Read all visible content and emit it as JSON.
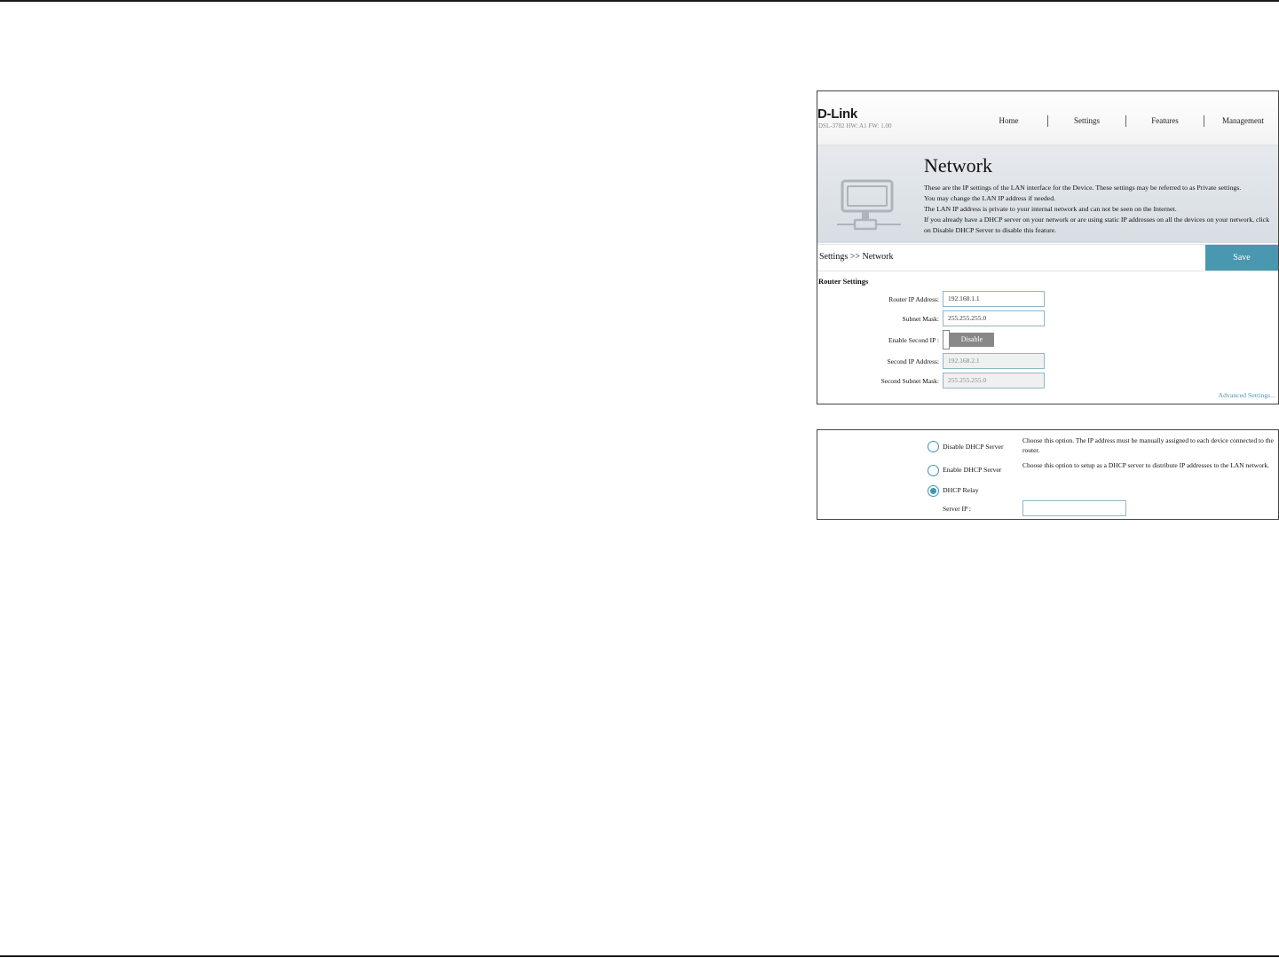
{
  "brand": {
    "logo": "D-Link",
    "model_info": "DSL-3782  HW: A1  FW: 1.00"
  },
  "nav": {
    "items": [
      "Home",
      "Settings",
      "Features",
      "Management"
    ]
  },
  "hero": {
    "title": "Network",
    "lines": [
      "These are the IP settings of the LAN interface for the Device. These settings may be referred to as Private settings.",
      "You may change the LAN IP address if needed.",
      "The LAN IP address is private to your internal network and can not be seen on the Internet.",
      "If you already have a DHCP server on your network or are using static IP addresses on all the devices on your network, click on Disable DHCP Server to disable this feature."
    ],
    "icon": "network-computer-icon"
  },
  "breadcrumb": "Settings >> Network",
  "save_label": "Save",
  "router_settings": {
    "title": "Router Settings",
    "router_ip": {
      "label": "Router IP Address:",
      "value": "192.168.1.1"
    },
    "subnet_mask": {
      "label": "Subnet Mask:",
      "value": "255.255.255.0"
    },
    "second_ip_toggle": {
      "label": "Enable Second IP :",
      "state": "Disable"
    },
    "second_ip": {
      "label": "Second IP Address:",
      "value": "192.168.2.1"
    },
    "second_mask": {
      "label": "Second Subnet Mask:",
      "value": "255.255.255.0"
    }
  },
  "advanced_link": "Advanced Settings...",
  "dhcp": {
    "options": [
      {
        "label": "Disable DHCP Server",
        "desc": "Choose this option. The IP address must be manually assigned to each device connected to the router.",
        "selected": false
      },
      {
        "label": "Enable DHCP Server",
        "desc": "Choose this option to setup as a DHCP server to distribute IP addresses to the LAN network.",
        "selected": false
      },
      {
        "label": "DHCP Relay",
        "desc": "",
        "selected": true
      }
    ],
    "server_ip": {
      "label": "Server IP :",
      "value": ""
    }
  },
  "colors": {
    "accent": "#4a97b0",
    "toggle_off": "#888888"
  }
}
